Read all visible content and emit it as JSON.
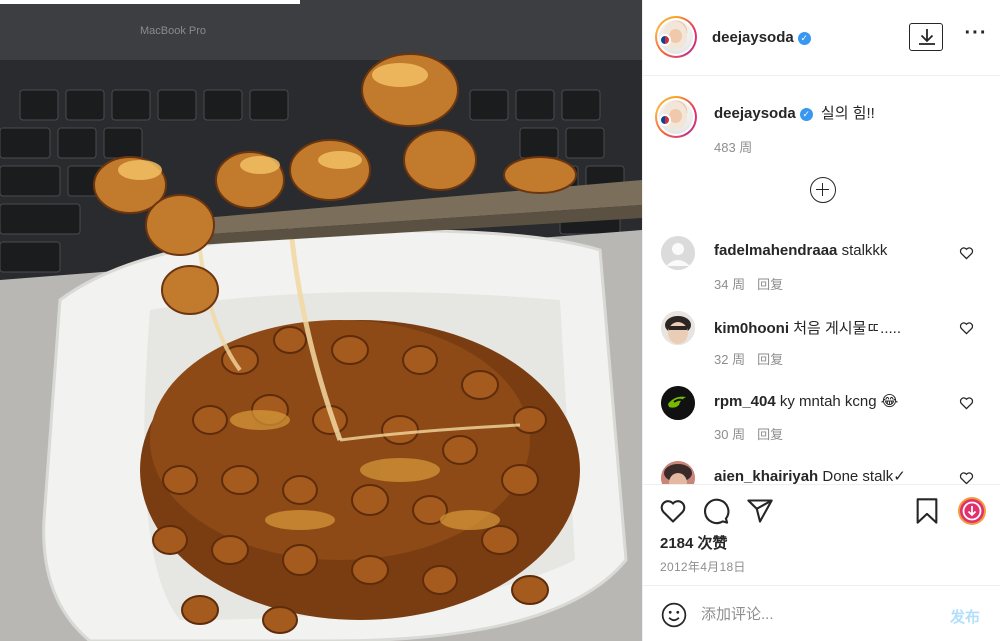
{
  "post": {
    "photo_icon": "natto-photo",
    "laptop_label": "MacBook Pro"
  },
  "header": {
    "username": "deejaysoda",
    "verified_icon": "verified-badge-icon",
    "download_icon": "download-icon",
    "more_icon": "more-options-icon"
  },
  "caption": {
    "username": "deejaysoda",
    "text": "실의 힘!!",
    "time": "483 周"
  },
  "load_more_icon": "plus-circle-icon",
  "comments": [
    {
      "username": "fadelmahendraaa",
      "text": "stalkkk",
      "time": "34 周",
      "reply": "回复"
    },
    {
      "username": "kim0hooni",
      "text": "처음 게시물ㄸ.....",
      "time": "32 周",
      "reply": "回复"
    },
    {
      "username": "rpm_404",
      "text": "ky mntah kcng 😂",
      "time": "30 周",
      "reply": "回复"
    },
    {
      "username": "aien_khairiyah",
      "text": "Done stalk✓",
      "time": "",
      "reply": ""
    }
  ],
  "actions": {
    "like_icon": "heart-icon",
    "comment_icon": "comment-icon",
    "share_icon": "share-icon",
    "save_icon": "bookmark-icon",
    "extension_icon": "download-circle-icon",
    "likes": "2184 次赞",
    "date": "2012年4月18日"
  },
  "add_comment": {
    "emoji_icon": "emoji-icon",
    "placeholder": "添加评论...",
    "post_label": "发布"
  },
  "colors": {
    "verified": "#3897f0",
    "post_button": "#b2dffc",
    "extension": "#e1306c"
  }
}
